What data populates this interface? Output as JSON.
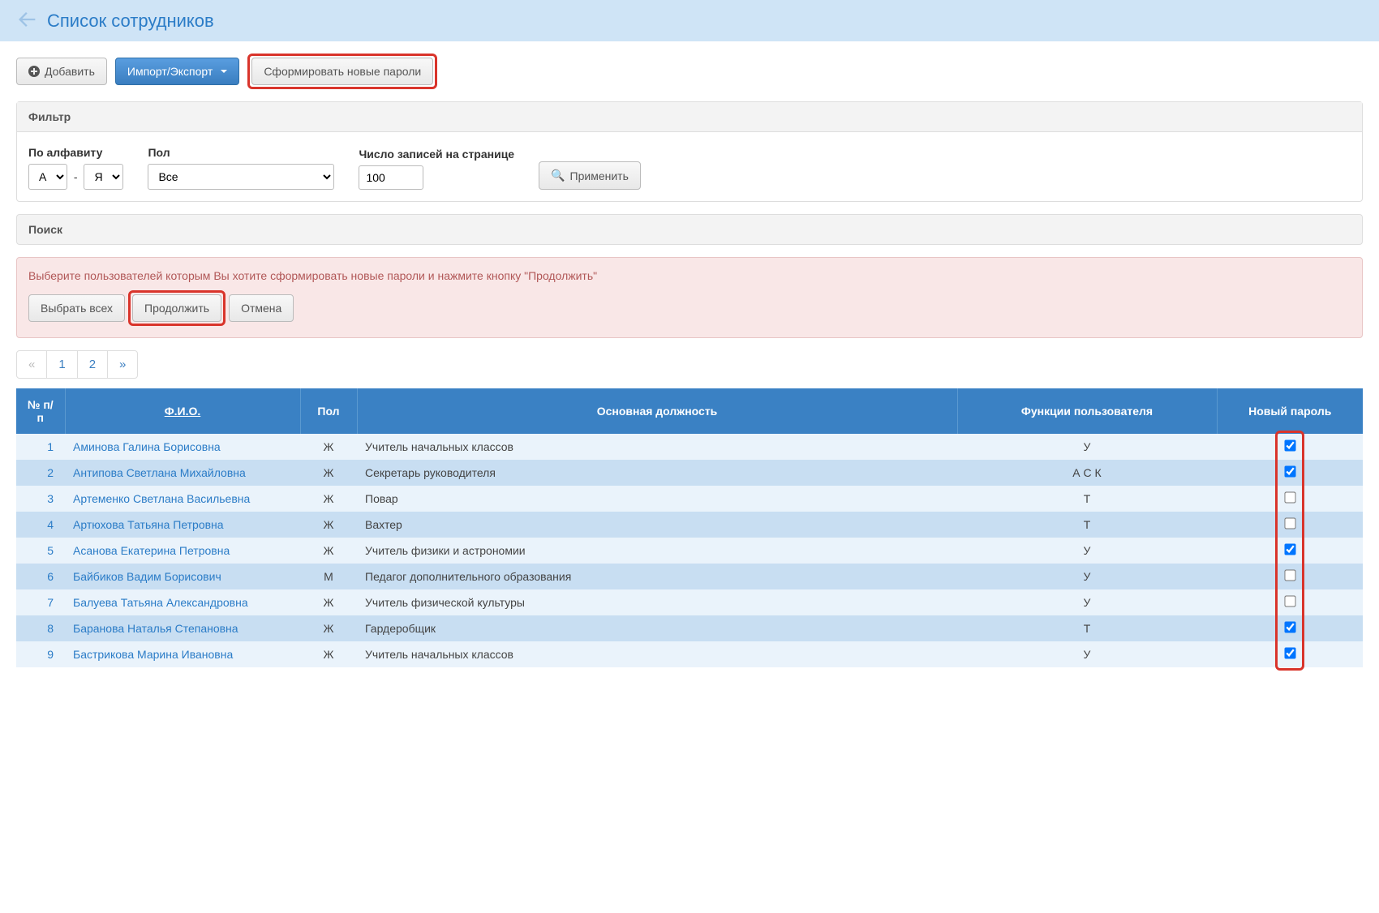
{
  "header": {
    "title": "Список сотрудников"
  },
  "toolbar": {
    "add": "Добавить",
    "import_export": "Импорт/Экспорт",
    "gen_passwords": "Сформировать новые пароли"
  },
  "filter": {
    "panel_title": "Фильтр",
    "alphabet_label": "По алфавиту",
    "alphabet_from": "А",
    "alphabet_to": "Я",
    "gender_label": "Пол",
    "gender_value": "Все",
    "page_size_label": "Число записей на странице",
    "page_size_value": "100",
    "apply": "Применить"
  },
  "search": {
    "panel_title": "Поиск"
  },
  "alert": {
    "text": "Выберите пользователей которым Вы хотите сформировать новые пароли и нажмите кнопку \"Продолжить\"",
    "select_all": "Выбрать всех",
    "continue": "Продолжить",
    "cancel": "Отмена"
  },
  "pagination": {
    "prev": "«",
    "pages": [
      "1",
      "2"
    ],
    "next": "»"
  },
  "table": {
    "headers": {
      "num": "№ п/п",
      "name": "Ф.И.О.",
      "gender": "Пол",
      "position": "Основная должность",
      "functions": "Функции пользователя",
      "new_password": "Новый пароль"
    },
    "rows": [
      {
        "n": "1",
        "name": "Аминова Галина Борисовна",
        "gender": "Ж",
        "position": "Учитель начальных классов",
        "func": "У",
        "checked": true
      },
      {
        "n": "2",
        "name": "Антипова Светлана Михайловна",
        "gender": "Ж",
        "position": "Секретарь руководителя",
        "func": "А С К",
        "checked": true
      },
      {
        "n": "3",
        "name": "Артеменко Светлана Васильевна",
        "gender": "Ж",
        "position": "Повар",
        "func": "Т",
        "checked": false
      },
      {
        "n": "4",
        "name": "Артюхова Татьяна Петровна",
        "gender": "Ж",
        "position": "Вахтер",
        "func": "Т",
        "checked": false
      },
      {
        "n": "5",
        "name": "Асанова Екатерина Петровна",
        "gender": "Ж",
        "position": "Учитель физики и астрономии",
        "func": "У",
        "checked": true
      },
      {
        "n": "6",
        "name": "Байбиков Вадим Борисович",
        "gender": "М",
        "position": "Педагог дополнительного образования",
        "func": "У",
        "checked": false
      },
      {
        "n": "7",
        "name": "Балуева Татьяна Александровна",
        "gender": "Ж",
        "position": "Учитель физической культуры",
        "func": "У",
        "checked": false
      },
      {
        "n": "8",
        "name": "Баранова Наталья Степановна",
        "gender": "Ж",
        "position": "Гардеробщик",
        "func": "Т",
        "checked": true
      },
      {
        "n": "9",
        "name": "Бастрикова Марина Ивановна",
        "gender": "Ж",
        "position": "Учитель начальных классов",
        "func": "У",
        "checked": true
      }
    ]
  }
}
